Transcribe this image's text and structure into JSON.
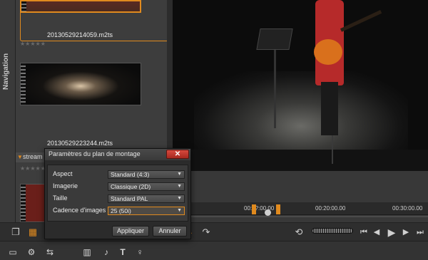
{
  "navigation": {
    "label": "Navigation"
  },
  "library": {
    "clips": [
      {
        "name": "20130529214059.m2ts",
        "stars": "★★★★★",
        "selected": true
      },
      {
        "name": "20130529223244.m2ts",
        "stars": "★★★★★",
        "selected": false
      },
      {
        "name": "",
        "stars": "★★★★★",
        "selected": false
      }
    ],
    "stream_group": {
      "label": "stream",
      "caret_icon": "caret-down-icon"
    }
  },
  "timeline": {
    "timecodes": [
      "00:1?:00.00",
      "00:20:00.00",
      "00:30:00.00"
    ]
  },
  "toolbar_top": {
    "icons": [
      "layers-icon",
      "grid-icon",
      "arrow-curve-icon",
      "marker-icon",
      "loop-icon",
      "prev-frame-icon",
      "step-back-icon",
      "play-icon",
      "step-forward-icon",
      "next-frame-icon"
    ]
  },
  "toolbar_bottom": {
    "icons": [
      "track-icon",
      "gear-icon",
      "tools-icon",
      "audio-bars-icon",
      "music-icon",
      "title-icon",
      "mic-icon"
    ]
  },
  "dialog": {
    "title": "Paramètres du plan de montage",
    "close_symbol": "✕",
    "rows": [
      {
        "label": "Aspect",
        "value": "Standard (4:3)"
      },
      {
        "label": "Imagerie",
        "value": "Classique (2D)"
      },
      {
        "label": "Taille",
        "value": "Standard PAL"
      },
      {
        "label": "Cadence d'images",
        "value": "25 (50i)"
      }
    ],
    "apply_label": "Appliquer",
    "cancel_label": "Annuler"
  },
  "colors": {
    "accent": "#e08a1e",
    "close_button": "#c73a2e",
    "panel_bg": "#3d3d3d"
  }
}
